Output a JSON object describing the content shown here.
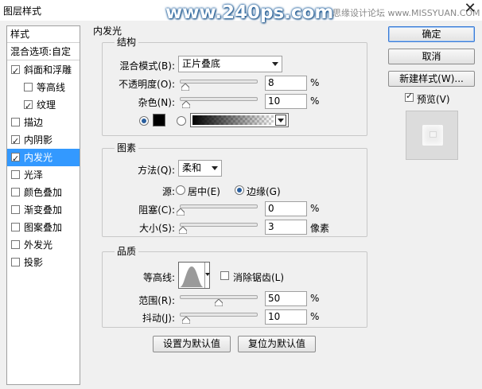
{
  "window": {
    "title": "图层样式",
    "close_glyph": "✕"
  },
  "watermarks": {
    "main": "www.240ps.com",
    "corner": "思缘设计论坛 www.MISSYUAN.COM"
  },
  "styles_panel": {
    "header": "样式",
    "blend_options": "混合选项:自定",
    "items": [
      {
        "label": "斜面和浮雕",
        "checked": true
      },
      {
        "label": "等高线",
        "checked": false
      },
      {
        "label": "纹理",
        "checked": true
      },
      {
        "label": "描边",
        "checked": false
      },
      {
        "label": "内阴影",
        "checked": true
      },
      {
        "label": "内发光",
        "checked": true,
        "selected": true
      },
      {
        "label": "光泽",
        "checked": false
      },
      {
        "label": "颜色叠加",
        "checked": false
      },
      {
        "label": "渐变叠加",
        "checked": false
      },
      {
        "label": "图案叠加",
        "checked": false
      },
      {
        "label": "外发光",
        "checked": false
      },
      {
        "label": "投影",
        "checked": false
      }
    ]
  },
  "inner_glow": {
    "section_title": "内发光",
    "structure": {
      "title": "结构",
      "blend_mode_label": "混合模式(B):",
      "blend_mode_value": "正片叠底",
      "opacity_label": "不透明度(O):",
      "opacity_value": "8",
      "opacity_unit": "%",
      "noise_label": "杂色(N):",
      "noise_value": "10",
      "noise_unit": "%",
      "color_swatch": "#000000",
      "color_radio_selected": true
    },
    "elements": {
      "title": "图素",
      "method_label": "方法(Q):",
      "method_value": "柔和",
      "source_label": "源:",
      "source_center": "居中(E)",
      "source_edge": "边缘(G)",
      "source_selected": "edge",
      "choke_label": "阻塞(C):",
      "choke_value": "0",
      "choke_unit": "%",
      "size_label": "大小(S):",
      "size_value": "3",
      "size_unit": "像素"
    },
    "quality": {
      "title": "品质",
      "contour_label": "等高线:",
      "antialias_label": "消除锯齿(L)",
      "antialias_checked": false,
      "range_label": "范围(R):",
      "range_value": "50",
      "range_unit": "%",
      "jitter_label": "抖动(J):",
      "jitter_value": "10",
      "jitter_unit": "%"
    },
    "make_default": "设置为默认值",
    "reset_default": "复位为默认值"
  },
  "right_panel": {
    "ok": "确定",
    "cancel": "取消",
    "new_style": "新建样式(W)...",
    "preview_label": "预览(V)",
    "preview_checked": true
  },
  "colors": {
    "selection": "#3399ff",
    "radio_dot": "#2a5f9e",
    "watermark_outline": "#1d5f9e"
  }
}
